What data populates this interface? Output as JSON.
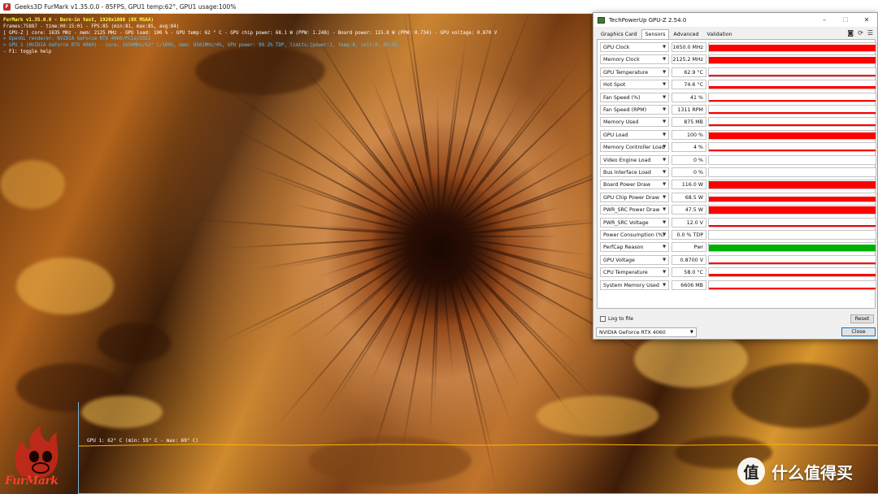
{
  "furmark": {
    "window_title": "Geeks3D FurMark v1.35.0.0 - 85FPS, GPU1 temp:62°, GPU1 usage:100%",
    "overlay": {
      "line1": "FurMark v1.35.0.0 - Burn-in test, 1920x1080 (8X MSAA)",
      "line2": "Frames:75887 - time:00:15:01 - FPS:85 (min:81, max:85, avg:84)",
      "line3": "[ GPU-Z ] core: 1635 MHz - mem: 2125 MHz - GPU load: 100 % - GPU temp: 62 ° C - GPU chip power: 68.1 W (PPW: 1.248) - Board power: 115.8 W (PPW: 0.734) - GPU voltage: 0.870 V",
      "line4": "> OpenGL renderer: NVIDIA GeForce RTX 4060/PCIe/SSE2",
      "line5": "> GPU 1 (NVIDIA GeForce RTX 4060) - core: 1650MHz/62° C/100%, mem: 8501MHz/4%, GPU power: 99.2% TDP, limits:[power:1, temp:0, volt:0, OV:0]",
      "line6": "- F1: toggle help"
    },
    "graph_label": "GPU 1: 62° C (min: 55° C - max: 69° C)",
    "logo_text": "FurMark"
  },
  "watermark": {
    "badge": "值",
    "text": "什么值得买"
  },
  "gpuz": {
    "title": "TechPowerUp GPU-Z 2.54.0",
    "window_buttons": [
      "–",
      "☐",
      "✕"
    ],
    "tabs": [
      "Graphics Card",
      "Sensors",
      "Advanced",
      "Validation"
    ],
    "active_tab": "Sensors",
    "tool_icons": [
      "camera-icon",
      "refresh-icon",
      "menu-icon"
    ],
    "sensors": [
      {
        "name": "GPU Clock",
        "value": "1650.0 MHz",
        "fill": 1.0,
        "color": "#ff0000"
      },
      {
        "name": "Memory Clock",
        "value": "2125.2 MHz",
        "fill": 1.0,
        "color": "#ff0000"
      },
      {
        "name": "GPU Temperature",
        "value": "62.9 °C",
        "fill": 0.2,
        "color": "#ff0000"
      },
      {
        "name": "Hot Spot",
        "value": "74.6 °C",
        "fill": 0.25,
        "color": "#ff0000"
      },
      {
        "name": "Fan Speed (%)",
        "value": "41 %",
        "fill": 0.15,
        "color": "#ff0000"
      },
      {
        "name": "Fan Speed (RPM)",
        "value": "1311 RPM",
        "fill": 0.15,
        "color": "#ff0000"
      },
      {
        "name": "Memory Used",
        "value": "875 MB",
        "fill": 0.15,
        "color": "#ff0000"
      },
      {
        "name": "GPU Load",
        "value": "100 %",
        "fill": 1.0,
        "color": "#ff0000"
      },
      {
        "name": "Memory Controller Load",
        "value": "4 %",
        "fill": 0.08,
        "color": "#ff0000"
      },
      {
        "name": "Video Engine Load",
        "value": "0 %",
        "fill": 0.0,
        "color": "#ff0000"
      },
      {
        "name": "Bus Interface Load",
        "value": "0 %",
        "fill": 0.0,
        "color": "#ff0000"
      },
      {
        "name": "Board Power Draw",
        "value": "116.0 W",
        "fill": 0.8,
        "color": "#ff0000"
      },
      {
        "name": "GPU Chip Power Draw",
        "value": "68.5 W",
        "fill": 0.55,
        "color": "#ff0000"
      },
      {
        "name": "PWR_SRC Power Draw",
        "value": "47.5 W",
        "fill": 0.8,
        "color": "#ff0000"
      },
      {
        "name": "PWR_SRC Voltage",
        "value": "12.0 V",
        "fill": 0.15,
        "color": "#ff0000"
      },
      {
        "name": "Power Consumption (%)",
        "value": "0.0 % TDP",
        "fill": 0.0,
        "color": "#ff0000"
      },
      {
        "name": "PerfCap Reason",
        "value": "Pwr",
        "fill": 1.0,
        "color": "#00b000"
      },
      {
        "name": "GPU Voltage",
        "value": "0.8700 V",
        "fill": 0.2,
        "color": "#ff0000"
      },
      {
        "name": "CPU Temperature",
        "value": "58.0 °C",
        "fill": 0.3,
        "color": "#ff0000"
      },
      {
        "name": "System Memory Used",
        "value": "6606 MB",
        "fill": 0.2,
        "color": "#ff0000"
      }
    ],
    "log_to_file": "Log to file",
    "reset": "Reset",
    "gpu_select": "NVIDIA GeForce RTX 4060",
    "close": "Close"
  }
}
